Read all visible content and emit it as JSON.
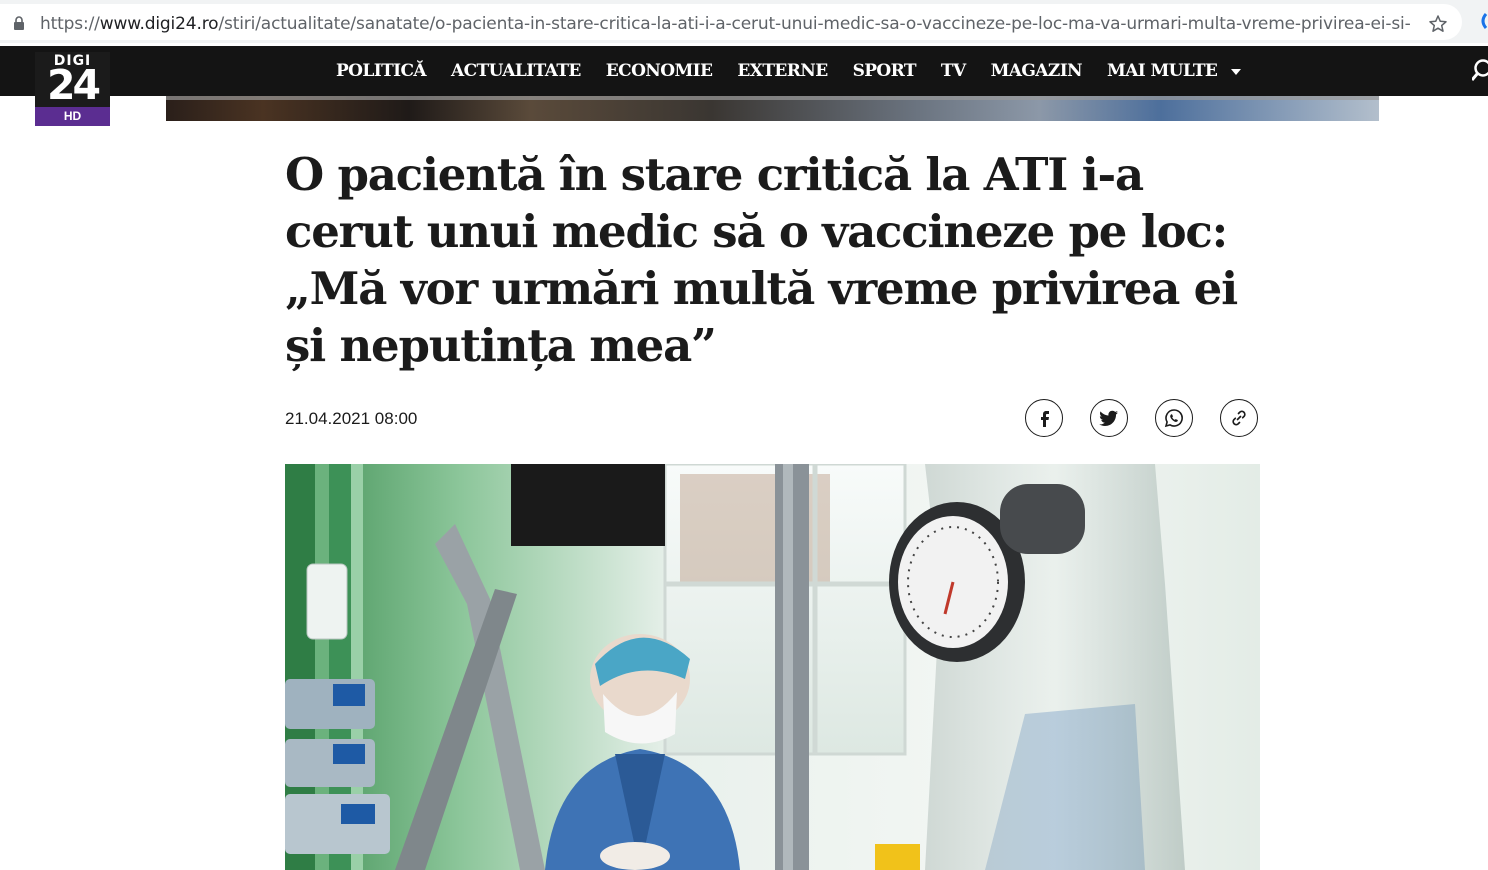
{
  "browser": {
    "url_prefix": "https://",
    "url_host": "www.digi24.ro",
    "url_path": "/stiri/actualitate/sanatate/o-pacienta-in-stare-critica-la-ati-i-a-cerut-unui-medic-sa-o-vaccineze-pe-loc-ma-va-urmari-multa-vreme-privirea-ei-si-neputint..."
  },
  "logo": {
    "top": "DIGI",
    "number": "24",
    "badge": "HD"
  },
  "nav": {
    "items": [
      "POLITICĂ",
      "ACTUALITATE",
      "ECONOMIE",
      "EXTERNE",
      "SPORT",
      "TV",
      "MAGAZIN"
    ],
    "more_label": "MAI MULTE"
  },
  "article": {
    "title": "O pacientă în stare critică la ATI i-a cerut unui medic să o vaccineze pe loc: „Mă vor urmări multă vreme privirea ei și neputința mea”",
    "date": "21.04.2021 08:00"
  },
  "share": [
    "facebook-icon",
    "twitter-icon",
    "whatsapp-icon",
    "link-icon"
  ],
  "colors": {
    "navbar": "#141414",
    "logo_badge": "#5b2d91",
    "text": "#1b1b1b"
  }
}
